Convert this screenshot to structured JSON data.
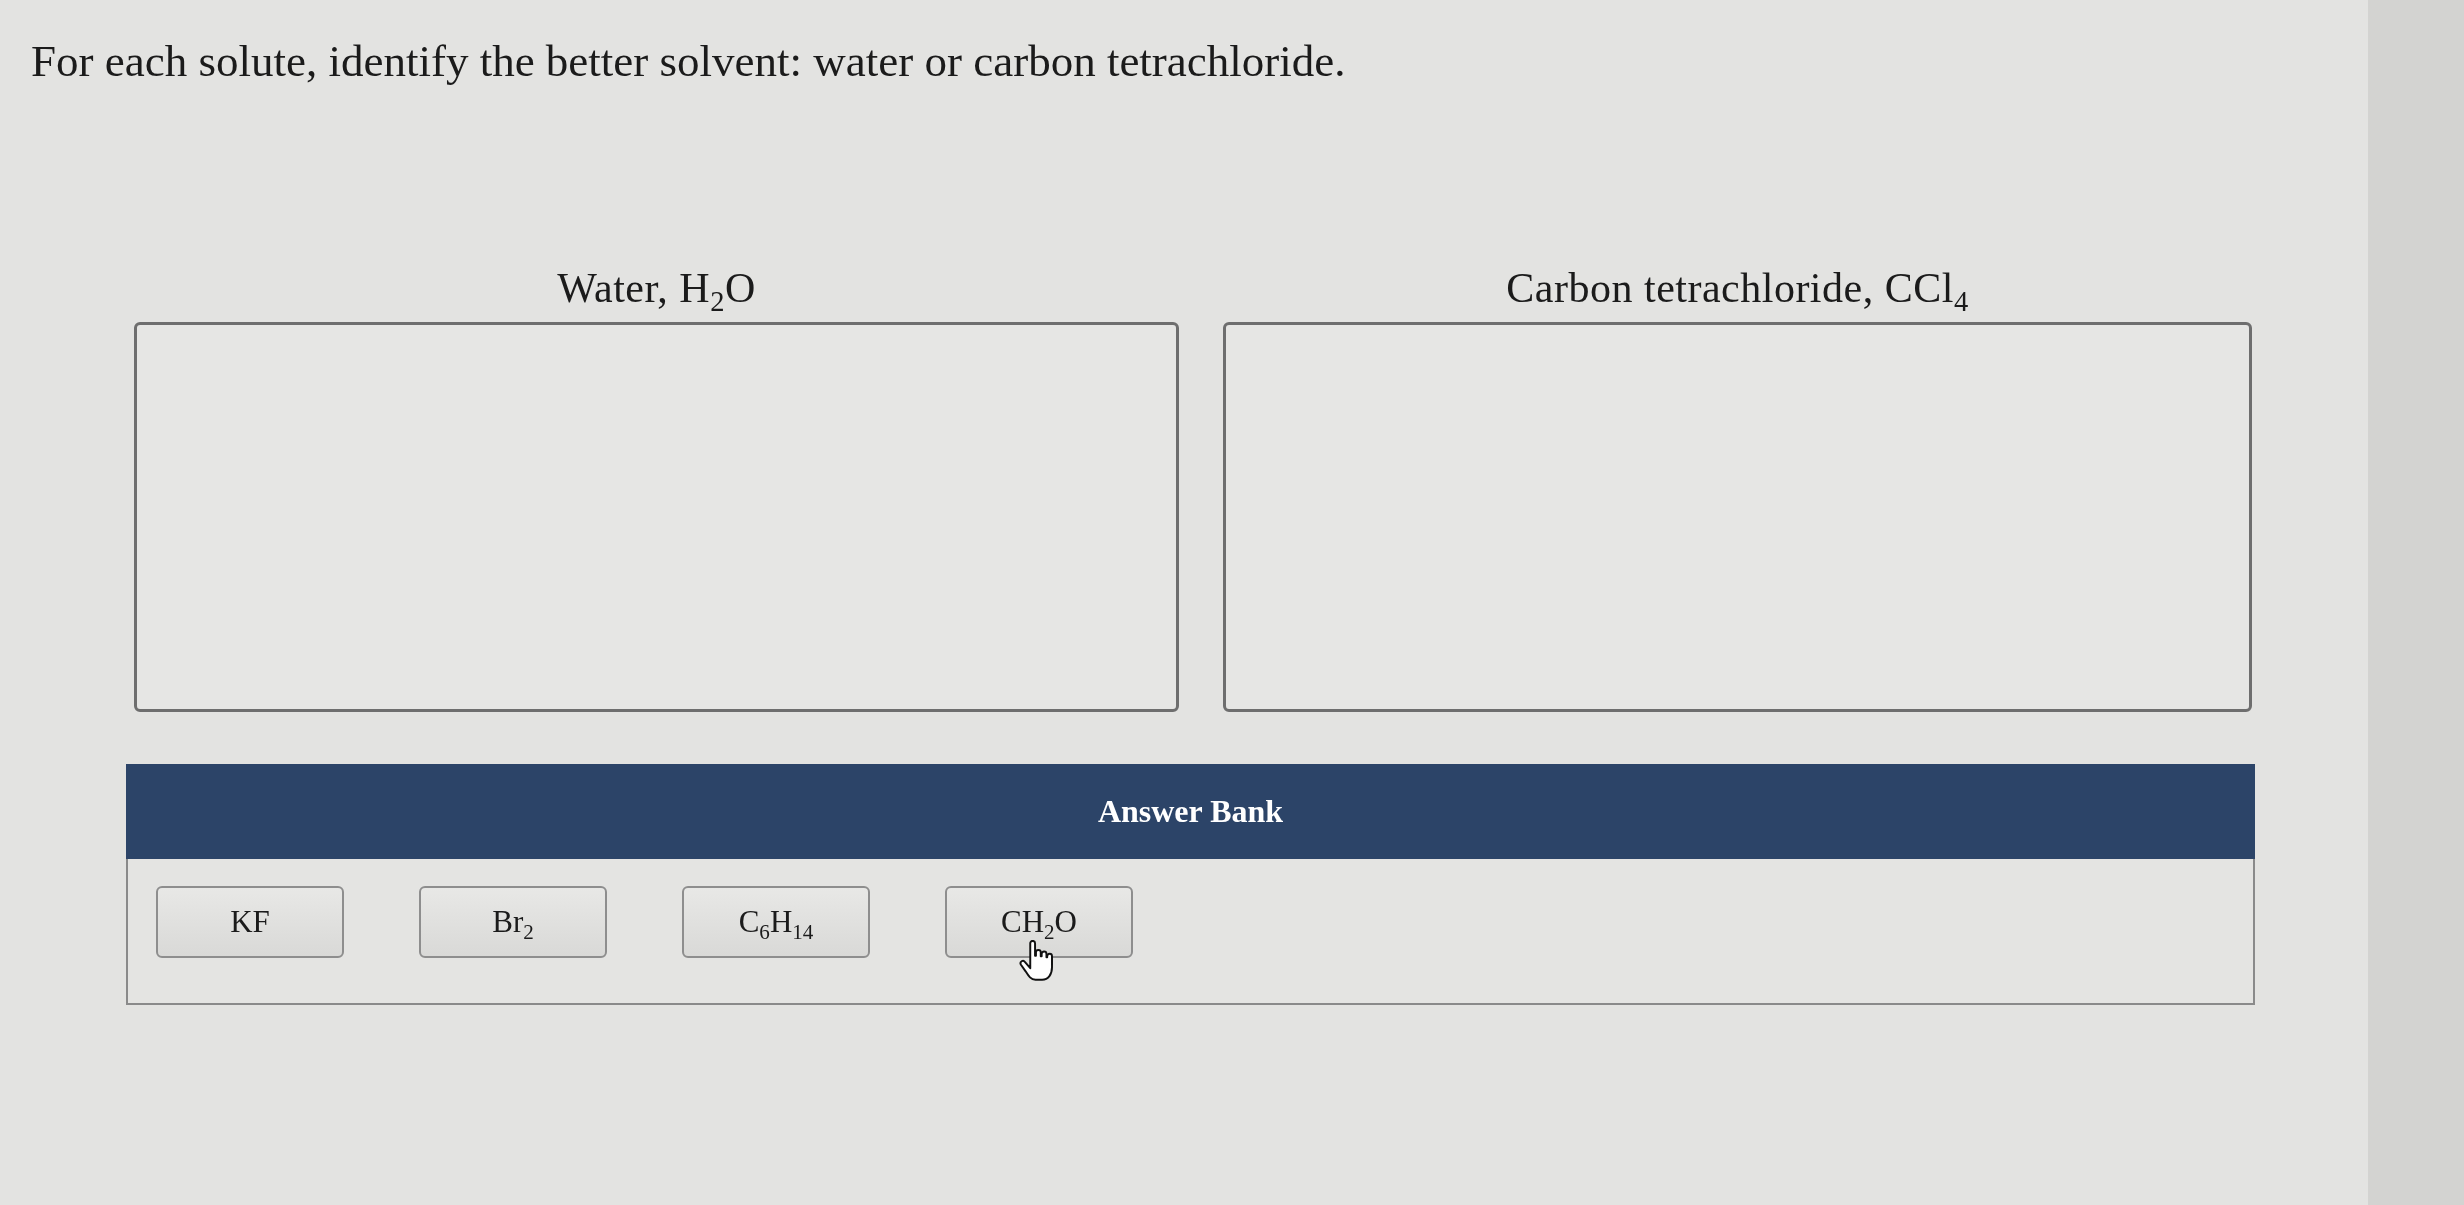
{
  "instruction": "For each solute, identify the better solvent: water or carbon tetrachloride.",
  "targets": [
    {
      "label": "Water, H$_{2}$O"
    },
    {
      "label": "Carbon tetrachloride, CCl$_{4}$"
    }
  ],
  "answer_bank": {
    "title": "Answer Bank",
    "items": [
      {
        "label": "KF",
        "hovered": false
      },
      {
        "label": "Br$_{2}$",
        "hovered": false
      },
      {
        "label": "C$_{6}$H$_{14}$",
        "hovered": false
      },
      {
        "label": "CH$_{2}$O",
        "hovered": true
      }
    ]
  }
}
